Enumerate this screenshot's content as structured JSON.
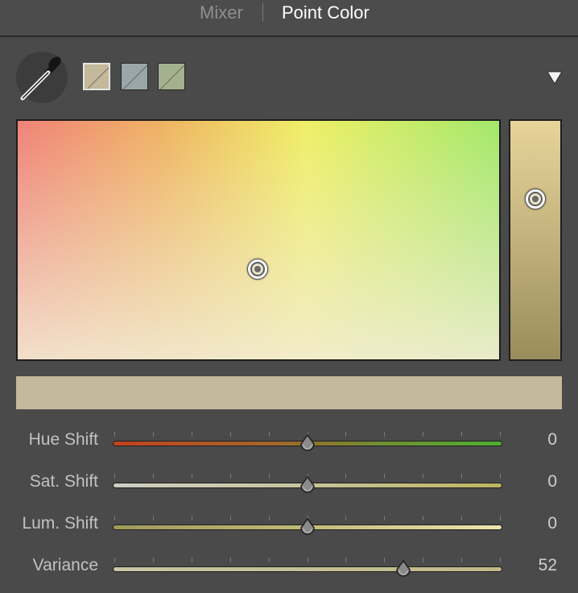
{
  "tabs": [
    {
      "label": "Mixer",
      "active": false
    },
    {
      "label": "Point Color",
      "active": true
    }
  ],
  "swatches": [
    {
      "color": "#c4b99b",
      "selected": true
    },
    {
      "color": "#9aa6a8",
      "selected": false
    },
    {
      "color": "#a3b18f",
      "selected": false
    }
  ],
  "color_field": {
    "selected_color": "#c4b99b"
  },
  "sliders": [
    {
      "label": "Hue Shift",
      "value": "0",
      "level": 0.5
    },
    {
      "label": "Sat. Shift",
      "value": "0",
      "level": 0.5
    },
    {
      "label": "Lum. Shift",
      "value": "0",
      "level": 0.5
    },
    {
      "label": "Variance",
      "value": "52",
      "level": 0.745
    }
  ],
  "icons": {
    "eyedropper": "eyedropper-icon",
    "menu": "dropdown-triangle-icon"
  },
  "colors": {
    "panel_bg": "#4a4a4a",
    "preview": "#c4b99b"
  }
}
